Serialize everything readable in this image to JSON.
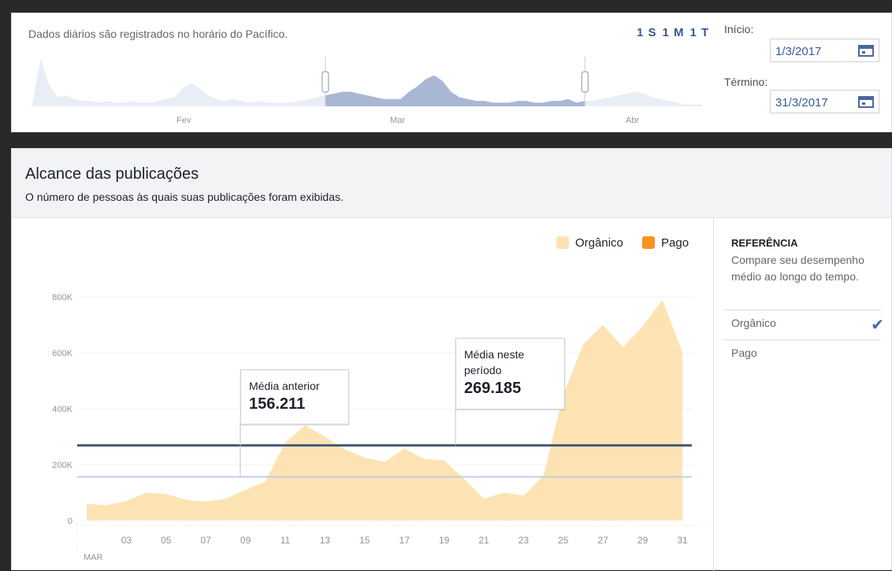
{
  "top": {
    "note": "Dados diários são registrados no horário do Pacífico.",
    "range_buttons": [
      "1 S",
      "1 M",
      "1 T"
    ],
    "start_label": "Início:",
    "start_value": "1/3/2017",
    "end_label": "Término:",
    "end_value": "31/3/2017",
    "months": [
      "Fev",
      "Mar",
      "Abr"
    ]
  },
  "panel": {
    "title": "Alcance das publicações",
    "subtitle": "O número de pessoas às quais suas publicações foram exibidas."
  },
  "legend": {
    "organic": "Orgânico",
    "paid": "Pago"
  },
  "callouts": {
    "previous_label": "Média anterior",
    "previous_value": "156.211",
    "current_label": "Média neste período",
    "current_value": "269.185"
  },
  "reference": {
    "title": "REFERÊNCIA",
    "description": "Compare seu desempenho médio ao longo do tempo.",
    "options": [
      "Orgânico",
      "Pago"
    ],
    "selected": "Orgânico"
  },
  "colors": {
    "organic": "#fde3b4",
    "paid": "#f7931e",
    "current_avg_line": "#4b5b7c",
    "previous_avg_line": "#c3cde0",
    "accent": "#365899"
  },
  "chart_data": {
    "type": "area",
    "x": [
      "01",
      "02",
      "03",
      "04",
      "05",
      "06",
      "07",
      "08",
      "09",
      "10",
      "11",
      "12",
      "13",
      "14",
      "15",
      "16",
      "17",
      "18",
      "19",
      "20",
      "21",
      "22",
      "23",
      "24",
      "25",
      "26",
      "27",
      "28",
      "29",
      "30",
      "31"
    ],
    "x_tick_labels": [
      "03",
      "05",
      "07",
      "09",
      "11",
      "13",
      "15",
      "17",
      "19",
      "21",
      "23",
      "25",
      "27",
      "29",
      "31"
    ],
    "x_axis_month": "MAR",
    "y_tick_labels": [
      "0",
      "200K",
      "400K",
      "600K",
      "800K"
    ],
    "ylim": [
      0,
      800000
    ],
    "series": [
      {
        "name": "Orgânico",
        "values": [
          60000,
          55000,
          70000,
          100000,
          95000,
          75000,
          68000,
          78000,
          110000,
          140000,
          280000,
          340000,
          300000,
          255000,
          225000,
          210000,
          258000,
          220000,
          215000,
          150000,
          78000,
          100000,
          90000,
          160000,
          450000,
          630000,
          700000,
          620000,
          695000,
          790000,
          600000
        ]
      }
    ],
    "reference_lines": [
      {
        "name": "Média neste período",
        "value": 269185
      },
      {
        "name": "Média anterior",
        "value": 156211
      }
    ],
    "overview": {
      "months": [
        "Fev",
        "Mar",
        "Abr"
      ],
      "values": [
        2,
        26,
        12,
        5,
        6,
        4,
        3,
        3,
        2,
        3,
        2,
        2,
        3,
        2,
        2,
        3,
        4,
        5,
        10,
        13,
        10,
        6,
        4,
        3,
        4,
        3,
        2,
        3,
        2,
        2,
        2,
        2,
        3,
        4,
        5,
        6,
        7,
        8,
        8,
        7,
        6,
        5,
        4,
        4,
        4,
        8,
        11,
        15,
        17,
        14,
        8,
        5,
        4,
        3,
        3,
        2,
        2,
        2,
        3,
        3,
        2,
        2,
        3,
        3,
        4,
        2,
        3,
        3,
        4,
        5,
        6,
        7,
        8,
        7,
        5,
        4,
        3,
        2,
        1,
        1,
        1
      ],
      "selected_start_index": 35,
      "selected_end_index": 66
    }
  }
}
